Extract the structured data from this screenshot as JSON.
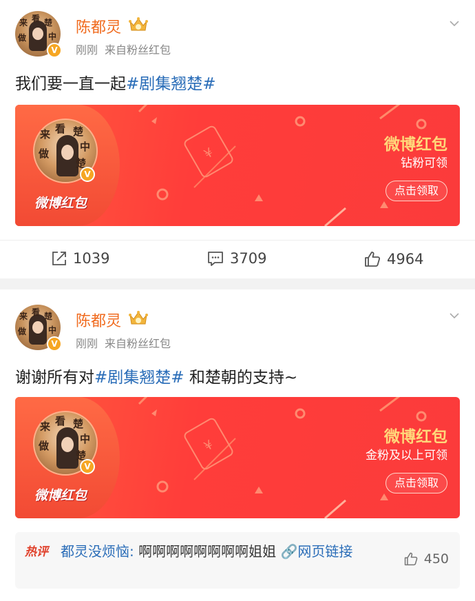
{
  "posts": [
    {
      "username": "陈都灵",
      "time": "刚刚",
      "source": "来自粉丝红包",
      "text_plain": "我们要一直一起",
      "topic": "#剧集翘楚#",
      "text_tail": "",
      "packet": {
        "label": "微博红包",
        "title": "微博红包",
        "sub": "钻粉可领",
        "button": "点击领取"
      },
      "actions": {
        "repost": "1039",
        "comment": "3709",
        "like": "4964"
      }
    },
    {
      "username": "陈都灵",
      "time": "刚刚",
      "source": "来自粉丝红包",
      "text_plain": "谢谢所有对",
      "topic": "#剧集翘楚#",
      "text_tail": " 和楚朝的支持~",
      "packet": {
        "label": "微博红包",
        "title": "微博红包",
        "sub": "金粉及以上可领",
        "button": "点击领取"
      }
    }
  ],
  "hot_comment": {
    "badge": "热评",
    "author": "都灵没烦恼:",
    "text": " 啊啊啊啊啊啊啊啊姐姐 ",
    "link": "🔗网页链接",
    "likes": "450"
  },
  "colors": {
    "username": "#f06a1d",
    "topic": "#2a6db8",
    "packet": "#ff3d3a",
    "packet_title": "#ffd77a"
  }
}
